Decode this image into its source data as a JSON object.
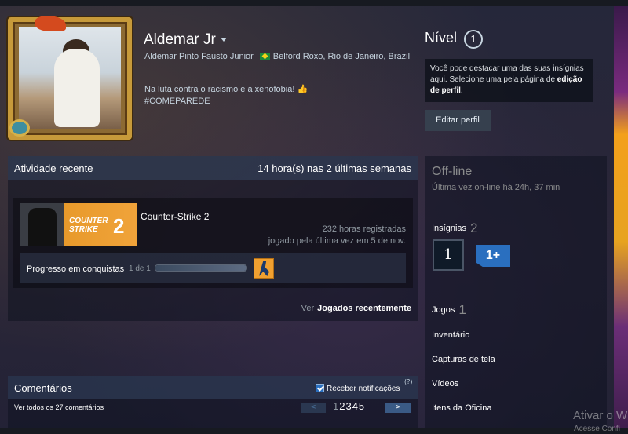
{
  "profile": {
    "name": "Aldemar Jr",
    "real_name": "Aldemar Pinto Fausto Junior",
    "location": "Belford Roxo, Rio de Janeiro, Brazil",
    "summary_line1": "Na luta contra o racismo e a xenofobia!",
    "summary_line2": "#COMEPAREDE"
  },
  "level": {
    "label": "Nível",
    "value": "1",
    "showcase_text": "Você pode destacar uma das suas insígnias aqui. Selecione uma pela página de ",
    "showcase_link": "edição de perfil",
    "showcase_end": ".",
    "edit_button": "Editar perfil"
  },
  "activity": {
    "title": "Atividade recente",
    "hours_summary": "14 hora(s) nas 2 últimas semanas",
    "game": {
      "name": "Counter-Strike 2",
      "art_text_line1": "COUNTER",
      "art_text_line2": "STRIKE",
      "art_number": "2",
      "hours": "232 horas registradas",
      "last_played": "jogado pela última vez em 5 de nov.",
      "ach_label": "Progresso em conquistas",
      "ach_count": "1 de 1",
      "ach_progress": 1.0
    },
    "view_prefix": "Ver",
    "view_link": "Jogados recentemente"
  },
  "sidebar": {
    "status": "Off-line",
    "last_online": "Última vez on-line há 24h, 37 min",
    "badges_label": "Insígnias",
    "badges_count": "2",
    "badge1": "1",
    "badge2": "1+",
    "games_label": "Jogos",
    "games_count": "1",
    "items": [
      "Inventário",
      "Capturas de tela",
      "Vídeos",
      "Itens da Oficina"
    ]
  },
  "comments": {
    "title": "Comentários",
    "notify_label": "Receber notificações",
    "help": "(?)",
    "view_all": "Ver todos os 27 comentários",
    "prev": "<",
    "current_page": "1",
    "other_pages": "2345",
    "next": ">"
  },
  "watermark": {
    "line1": "Ativar o W",
    "line2": "Acesse Confi"
  },
  "colors": {
    "accent": "#2a6fbf",
    "frame_gold": "#c79a3a",
    "cs_orange": "#f0a33a"
  }
}
